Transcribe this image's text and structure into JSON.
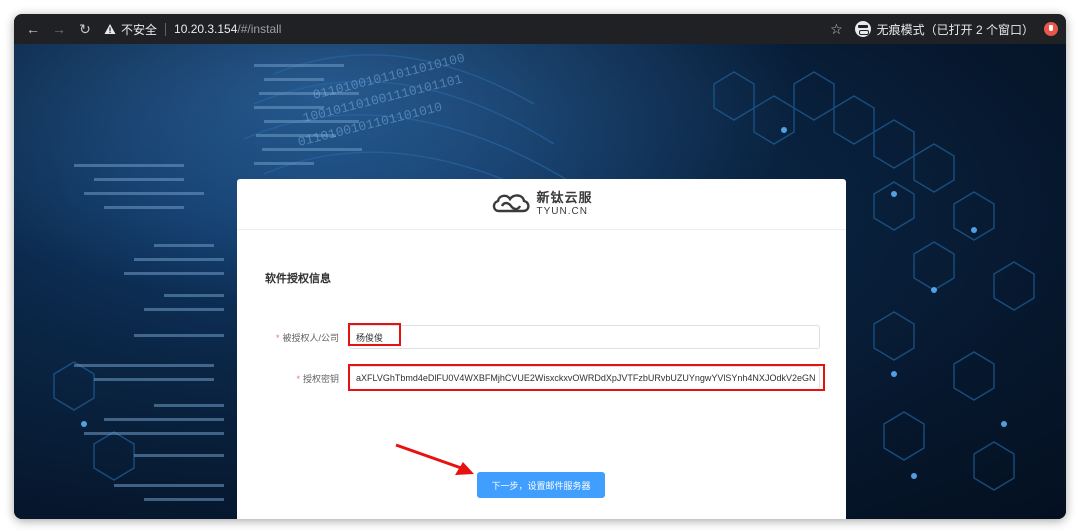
{
  "browser": {
    "security_label": "不安全",
    "url_host": "10.20.3.154",
    "url_path": "/#/install",
    "incognito_label": "无痕模式（已打开 2 个窗口）"
  },
  "logo": {
    "name_cn": "新钛云服",
    "name_en": "TYUN.CN"
  },
  "form": {
    "section_title": "软件授权信息",
    "licensee_label": "被授权人/公司",
    "licensee_value": "杨俊俊",
    "license_key_label": "授权密钥",
    "license_key_value": "aXFLVGhTbmd4eDlFU0V4WXBFMjhCVUE2WisxckxvOWRDdXpJVTFzbURvbUZUYngwYVlSYnh4NXJOdkV2eGN",
    "required_mark": "*",
    "submit_label": "下一步，设置邮件服务器"
  },
  "annotations": {
    "highlight_color": "#e8110f"
  },
  "colors": {
    "primary": "#409eff",
    "toolbar": "#202124"
  }
}
